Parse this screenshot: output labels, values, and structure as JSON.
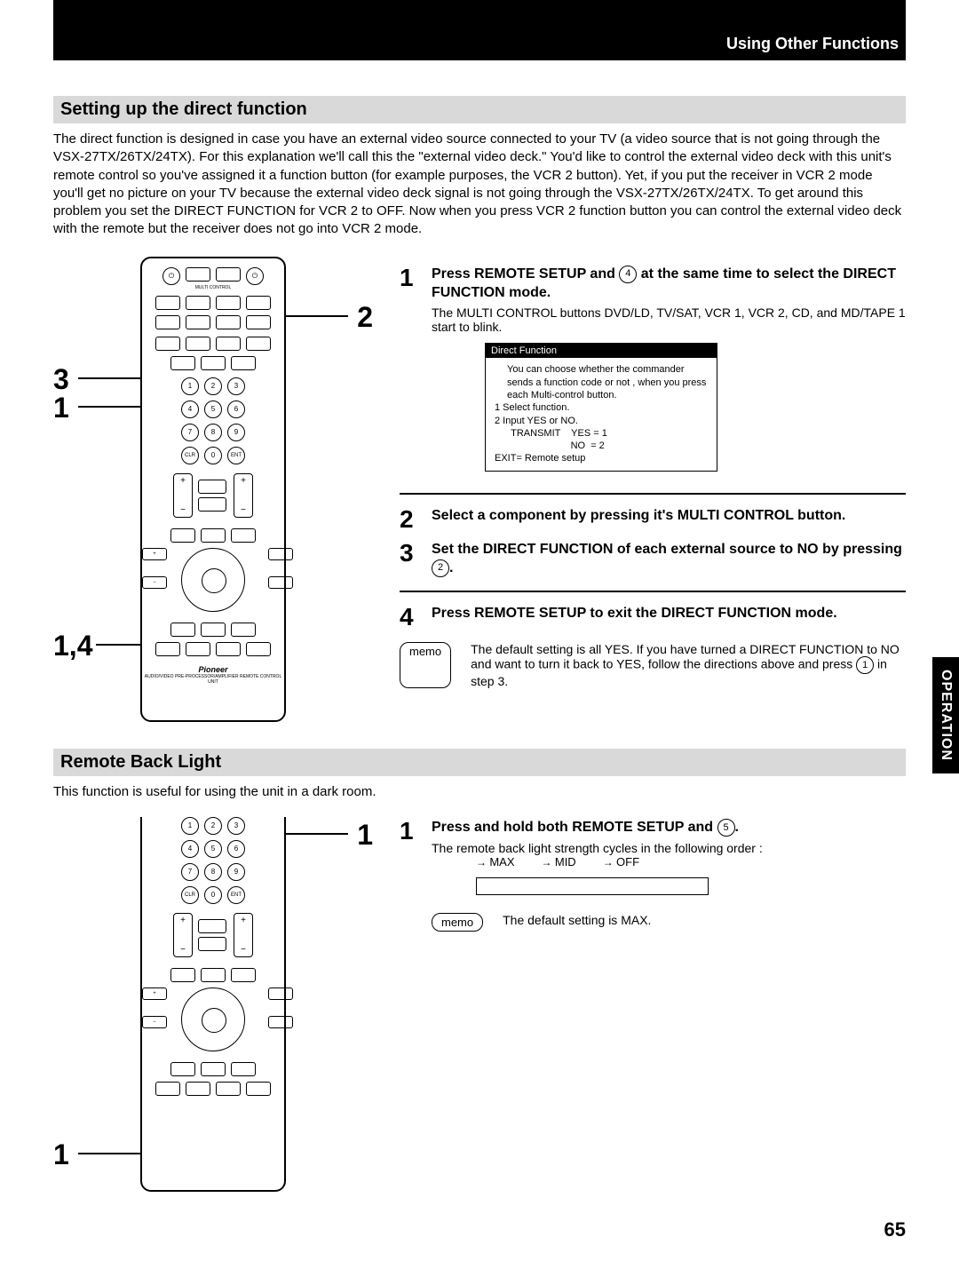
{
  "header": {
    "breadcrumb": "Using Other Functions"
  },
  "section1": {
    "title": "Setting up the direct function",
    "intro": "The direct function is designed in case you have an external video source connected to your TV (a video source that is not going through the VSX-27TX/26TX/24TX). For this explanation we'll call this the  \"external video deck.\" You'd like to control the external video deck with this unit's remote control so you've assigned it a function button (for example purposes, the VCR 2 button). Yet, if you put the receiver in VCR 2 mode you'll get no picture on your TV because the external video deck signal is not going through the VSX-27TX/26TX/24TX. To get around this problem you set the DIRECT FUNCTION for VCR 2 to OFF. Now when you press VCR 2  function button you can control the external video deck with the remote but the receiver does not go into VCR 2 mode.",
    "callouts": {
      "a": "2",
      "b": "3",
      "c": "1",
      "d": "1,4"
    },
    "step1": {
      "num": "1",
      "title_pre": "Press REMOTE SETUP and ",
      "title_circle": "4",
      "title_post": " at the same time to select the DIRECT FUNCTION mode.",
      "desc": "The MULTI CONTROL buttons DVD/LD, TV/SAT, VCR 1, VCR 2, CD, and MD/TAPE 1 start to blink.",
      "inset": {
        "title": "Direct Function",
        "body1": "You can choose whether the commander sends a function code or not , when you press each Multi-control button.",
        "line1": "1 Select function.",
        "line2": "2 Input YES or NO.",
        "line3": "      TRANSMIT    YES = 1",
        "line4": "                            NO  = 2",
        "line5": "EXIT= Remote setup"
      }
    },
    "step2": {
      "num": "2",
      "title": "Select a component by pressing it's MULTI CONTROL button."
    },
    "step3": {
      "num": "3",
      "title_pre": "Set the DIRECT FUNCTION of each external source to NO by pressing ",
      "title_circle": "2",
      "title_post": "."
    },
    "step4": {
      "num": "4",
      "title": "Press REMOTE SETUP to exit the DIRECT FUNCTION  mode."
    },
    "memo": {
      "label": "memo",
      "text_pre": "The default setting is all YES. If you have turned a DIRECT FUNCTION to NO and want to turn it back to YES, follow the directions above and press ",
      "circle": "1",
      "text_post": "  in step 3."
    }
  },
  "section2": {
    "title": "Remote Back Light",
    "intro": "This function is useful for using the unit in a dark room.",
    "callouts": {
      "a": "1",
      "b": "1"
    },
    "step1": {
      "num": "1",
      "title_pre": "Press and hold both REMOTE SETUP and ",
      "title_circle": "5",
      "title_post": ".",
      "desc": "The remote back light strength cycles in the following order :"
    },
    "cycle": {
      "a": "MAX",
      "b": "MID",
      "c": "OFF"
    },
    "memo": {
      "label": "memo",
      "text": "The default setting is MAX."
    }
  },
  "sideTab": "OPERATION",
  "pageNum": "65",
  "remote": {
    "brand": "Pioneer",
    "model": "AUDIO/VIDEO PRE-PROCESSOR/AMPLIFIER REMOTE CONTROL UNIT"
  }
}
